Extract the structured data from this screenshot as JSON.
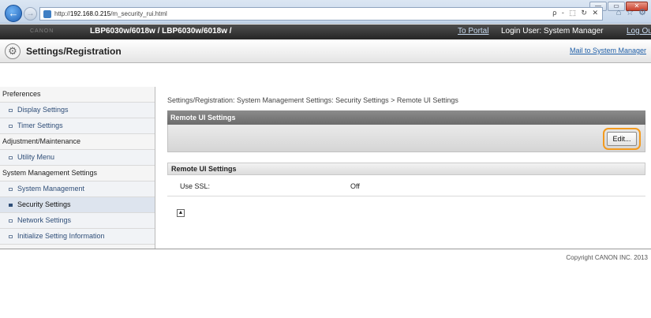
{
  "browser": {
    "url_prefix": "http://",
    "url_host": "192.168.0.215",
    "url_path": "/m_security_rui.html",
    "addr_tools": "ρ - ⬚ ↻ ✕",
    "win_min": "—",
    "win_max": "▭",
    "win_close": "✕"
  },
  "device": {
    "logo": "CANON",
    "name": "LBP6030w/6018w / LBP6030w/6018w /",
    "to_portal": "To Portal",
    "login_user": "Login User: System Manager",
    "logout": "Log Out"
  },
  "page": {
    "title": "Settings/Registration",
    "mail_link": "Mail to System Manager"
  },
  "sidebar": {
    "items": [
      {
        "label": "Preferences"
      },
      {
        "label": "Display Settings"
      },
      {
        "label": "Timer Settings"
      },
      {
        "label": "Adjustment/Maintenance"
      },
      {
        "label": "Utility Menu"
      },
      {
        "label": "System Management Settings"
      },
      {
        "label": "System Management"
      },
      {
        "label": "Security Settings"
      },
      {
        "label": "Network Settings"
      },
      {
        "label": "Initialize Setting Information"
      }
    ]
  },
  "main": {
    "breadcrumb": "Settings/Registration: System Management Settings: Security Settings > Remote UI Settings",
    "section_title": "Remote UI Settings",
    "edit_label": "Edit...",
    "settings_title": "Remote UI Settings",
    "use_ssl_label": "Use SSL:",
    "use_ssl_value": "Off"
  },
  "footer": {
    "copyright": "Copyright CANON INC. 2013"
  }
}
